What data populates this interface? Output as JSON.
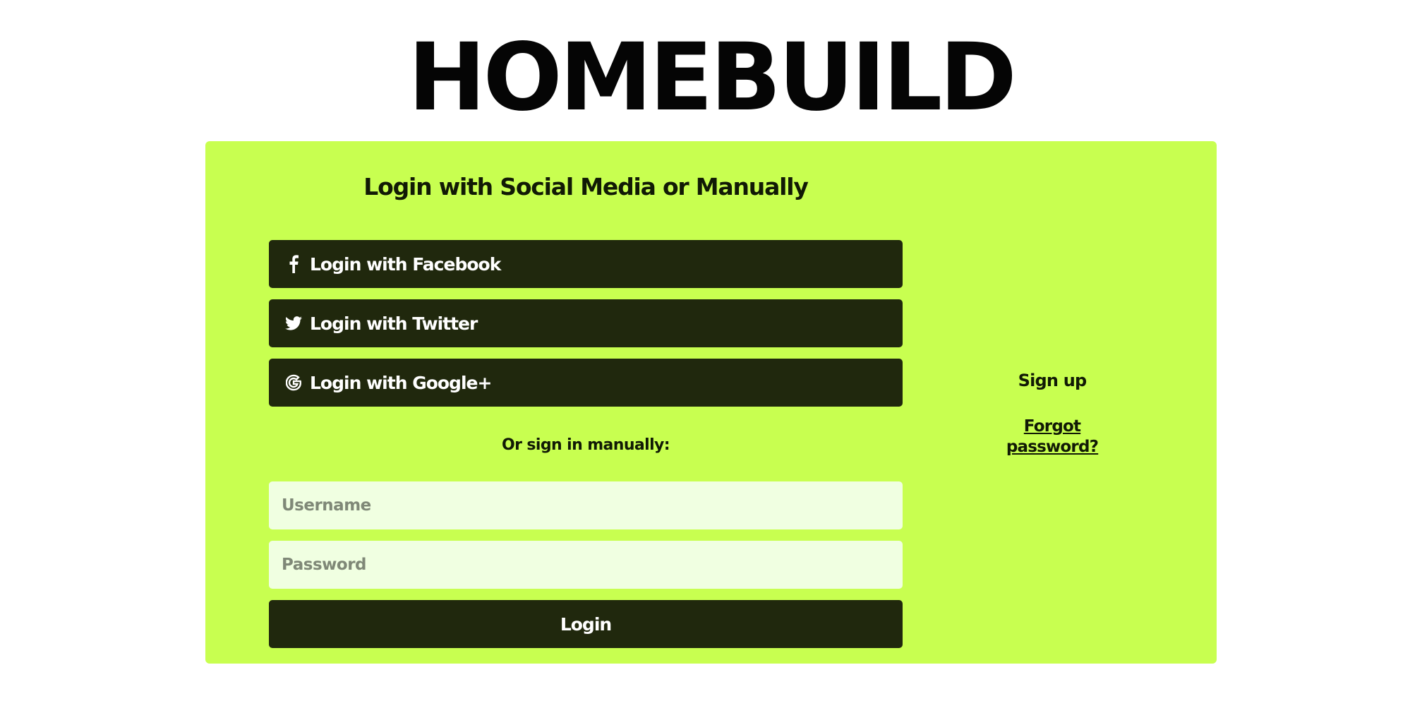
{
  "brand": {
    "name": "HOMEBUILD"
  },
  "login_panel": {
    "heading": "Login with Social Media or Manually",
    "social_buttons": [
      {
        "label": "Login with Facebook",
        "icon": "facebook-icon"
      },
      {
        "label": "Login with Twitter",
        "icon": "twitter-icon"
      },
      {
        "label": "Login with Google+",
        "icon": "google-icon"
      }
    ],
    "manual_label": "Or sign in manually:",
    "username_placeholder": "Username",
    "password_placeholder": "Password",
    "login_button": "Login"
  },
  "side_links": {
    "sign_up": "Sign up",
    "forgot_password": "Forgot password?"
  },
  "colors": {
    "panel_background": "#c8ff50",
    "button_background": "#20280d",
    "input_background": "#f0ffe1",
    "text_dark": "#111a05"
  }
}
